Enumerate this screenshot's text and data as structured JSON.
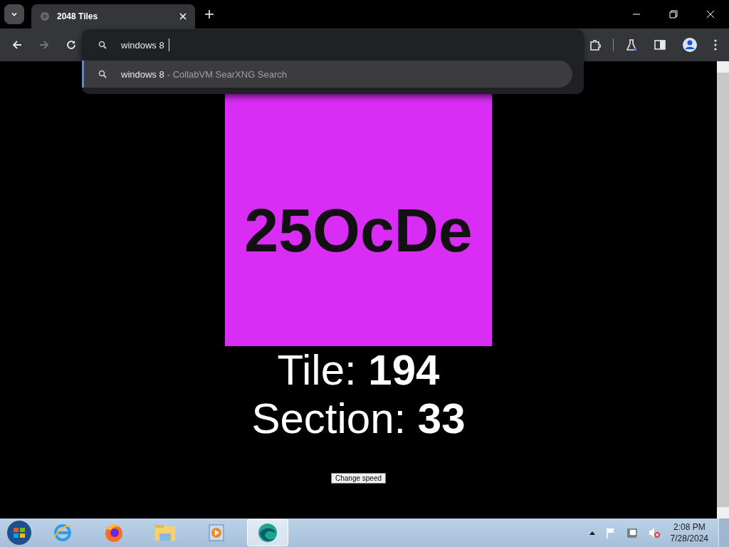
{
  "tab": {
    "title": "2048 Tiles",
    "selected": true
  },
  "omnibox": {
    "value": "windows 8",
    "suggestion": {
      "query": "windows 8",
      "source": "- CollabVM SearXNG Search",
      "selected": true
    }
  },
  "tile": {
    "text": "25OcDe"
  },
  "stats": [
    "Tile: **194**",
    "Section: **33**"
  ],
  "button": "Change speed",
  "taskbar": {
    "items": [
      {
        "kind": "ie",
        "selected": false
      },
      {
        "kind": "firefox",
        "selected": false
      },
      {
        "kind": "folder",
        "selected": false
      },
      {
        "kind": "media",
        "selected": false
      },
      {
        "kind": "edge",
        "selected": true
      }
    ],
    "clock": {
      "time": "2:08 PM",
      "date": "7/28/2024"
    }
  }
}
